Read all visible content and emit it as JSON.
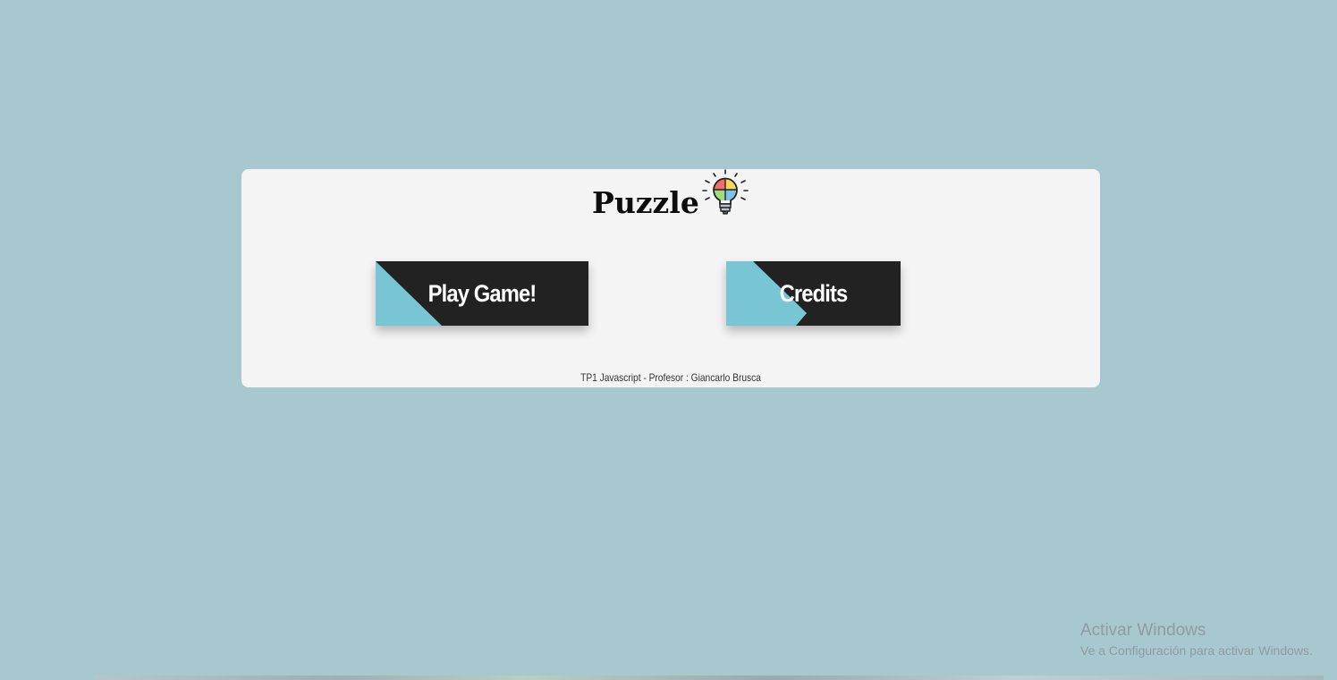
{
  "app": {
    "title": "Puzzle",
    "logo_icon": "lightbulb-puzzle-icon"
  },
  "menu": {
    "play_label": "Play Game!",
    "credits_label": "Credits"
  },
  "footer": {
    "text": "TP1 Javascript - Profesor : Giancarlo Brusca"
  },
  "watermark": {
    "title": "Activar Windows",
    "subtitle": "Ve a Configuración para activar Windows."
  },
  "colors": {
    "background": "#a8c8cf",
    "card": "#f4f4f4",
    "button": "#222222",
    "button_accent": "#78c6d3",
    "text_dark": "#0d0d0d"
  }
}
